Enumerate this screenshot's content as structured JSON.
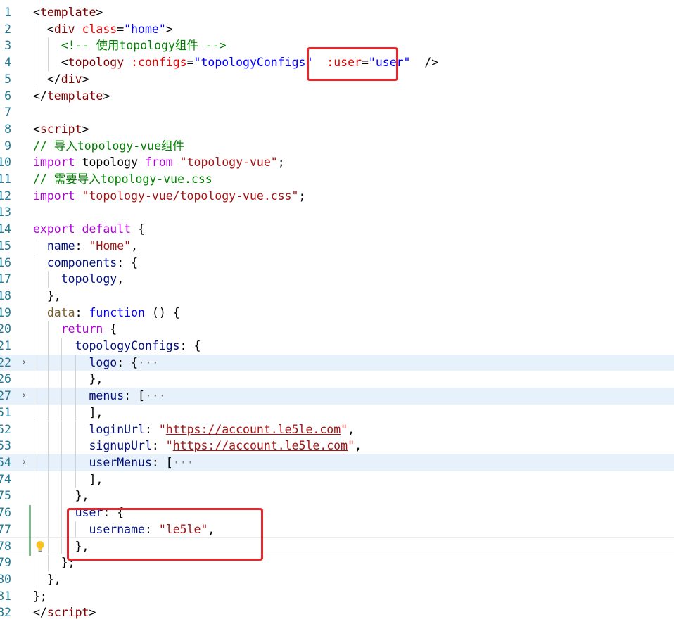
{
  "editor": {
    "lines": [
      {
        "n": "1",
        "fold": "",
        "cls": "",
        "html_tokens": [
          [
            "t-punc",
            "<"
          ],
          [
            "t-tag",
            "template"
          ],
          [
            "t-punc",
            ">"
          ]
        ]
      },
      {
        "n": "2",
        "fold": "",
        "cls": "",
        "html_tokens": [
          [
            "t-punc",
            "  <"
          ],
          [
            "t-tag",
            "div"
          ],
          [
            "t-punc",
            " "
          ],
          [
            "t-attr",
            "class"
          ],
          [
            "t-punc",
            "="
          ],
          [
            "t-kw",
            "\"home\""
          ],
          [
            "t-punc",
            ">"
          ]
        ]
      },
      {
        "n": "3",
        "fold": "",
        "cls": "",
        "html_tokens": [
          [
            "t-com",
            "    <!-- 使用topology组件 -->"
          ]
        ]
      },
      {
        "n": "4",
        "fold": "",
        "cls": "",
        "html_tokens": [
          [
            "t-punc",
            "    <"
          ],
          [
            "t-tag",
            "topology"
          ],
          [
            "t-punc",
            " "
          ],
          [
            "t-attr",
            ":configs"
          ],
          [
            "t-punc",
            "="
          ],
          [
            "t-kw",
            "\"topologyConfigs\""
          ],
          [
            "t-punc",
            "  "
          ],
          [
            "t-attr",
            ":user"
          ],
          [
            "t-punc",
            "="
          ],
          [
            "t-kw",
            "\"user\""
          ],
          [
            "t-punc",
            "  />"
          ]
        ]
      },
      {
        "n": "5",
        "fold": "",
        "cls": "",
        "html_tokens": [
          [
            "t-punc",
            "  </"
          ],
          [
            "t-tag",
            "div"
          ],
          [
            "t-punc",
            ">"
          ]
        ]
      },
      {
        "n": "6",
        "fold": "",
        "cls": "",
        "html_tokens": [
          [
            "t-punc",
            "</"
          ],
          [
            "t-tag",
            "template"
          ],
          [
            "t-punc",
            ">"
          ]
        ]
      },
      {
        "n": "7",
        "fold": "",
        "cls": "",
        "html_tokens": []
      },
      {
        "n": "8",
        "fold": "",
        "cls": "",
        "html_tokens": [
          [
            "t-punc",
            "<"
          ],
          [
            "t-tag",
            "script"
          ],
          [
            "t-punc",
            ">"
          ]
        ]
      },
      {
        "n": "9",
        "fold": "",
        "cls": "",
        "html_tokens": [
          [
            "t-com",
            "// 导入topology-vue组件"
          ]
        ]
      },
      {
        "n": "10",
        "fold": "",
        "cls": "",
        "html_tokens": [
          [
            "t-ctl",
            "import"
          ],
          [
            "t-punc",
            " topology "
          ],
          [
            "t-ctl",
            "from"
          ],
          [
            "t-punc",
            " "
          ],
          [
            "t-str",
            "\"topology-vue\""
          ],
          [
            "t-punc",
            ";"
          ]
        ]
      },
      {
        "n": "11",
        "fold": "",
        "cls": "",
        "html_tokens": [
          [
            "t-com",
            "// 需要导入topology-vue.css"
          ]
        ]
      },
      {
        "n": "12",
        "fold": "",
        "cls": "",
        "html_tokens": [
          [
            "t-ctl",
            "import"
          ],
          [
            "t-punc",
            " "
          ],
          [
            "t-str",
            "\"topology-vue/topology-vue.css\""
          ],
          [
            "t-punc",
            ";"
          ]
        ]
      },
      {
        "n": "13",
        "fold": "",
        "cls": "",
        "html_tokens": []
      },
      {
        "n": "14",
        "fold": "",
        "cls": "",
        "html_tokens": [
          [
            "t-ctl",
            "export"
          ],
          [
            "t-punc",
            " "
          ],
          [
            "t-ctl",
            "default"
          ],
          [
            "t-punc",
            " {"
          ]
        ]
      },
      {
        "n": "15",
        "fold": "",
        "cls": "",
        "html_tokens": [
          [
            "t-punc",
            "  "
          ],
          [
            "t-prop",
            "name"
          ],
          [
            "t-punc",
            ": "
          ],
          [
            "t-str",
            "\"Home\""
          ],
          [
            "t-punc",
            ","
          ]
        ]
      },
      {
        "n": "16",
        "fold": "",
        "cls": "",
        "html_tokens": [
          [
            "t-punc",
            "  "
          ],
          [
            "t-prop",
            "components"
          ],
          [
            "t-punc",
            ": {"
          ]
        ]
      },
      {
        "n": "17",
        "fold": "",
        "cls": "",
        "html_tokens": [
          [
            "t-punc",
            "    "
          ],
          [
            "t-prop",
            "topology"
          ],
          [
            "t-punc",
            ","
          ]
        ]
      },
      {
        "n": "18",
        "fold": "",
        "cls": "",
        "html_tokens": [
          [
            "t-punc",
            "  },"
          ]
        ]
      },
      {
        "n": "19",
        "fold": "",
        "cls": "",
        "html_tokens": [
          [
            "t-punc",
            "  "
          ],
          [
            "t-fn",
            "data"
          ],
          [
            "t-punc",
            ": "
          ],
          [
            "t-kw",
            "function"
          ],
          [
            "t-punc",
            " () {"
          ]
        ]
      },
      {
        "n": "20",
        "fold": "",
        "cls": "",
        "html_tokens": [
          [
            "t-punc",
            "    "
          ],
          [
            "t-ctl",
            "return"
          ],
          [
            "t-punc",
            " {"
          ]
        ]
      },
      {
        "n": "21",
        "fold": "",
        "cls": "",
        "html_tokens": [
          [
            "t-punc",
            "      "
          ],
          [
            "t-prop",
            "topologyConfigs"
          ],
          [
            "t-punc",
            ": {"
          ]
        ]
      },
      {
        "n": "22",
        "fold": "›",
        "cls": "folded",
        "html_tokens": [
          [
            "t-punc",
            "        "
          ],
          [
            "t-prop",
            "logo"
          ],
          [
            "t-punc",
            ": {"
          ],
          [
            "t-fold",
            "···"
          ]
        ]
      },
      {
        "n": "26",
        "fold": "",
        "cls": "",
        "html_tokens": [
          [
            "t-punc",
            "        },"
          ]
        ]
      },
      {
        "n": "27",
        "fold": "›",
        "cls": "folded",
        "html_tokens": [
          [
            "t-punc",
            "        "
          ],
          [
            "t-prop",
            "menus"
          ],
          [
            "t-punc",
            ": ["
          ],
          [
            "t-fold",
            "···"
          ]
        ]
      },
      {
        "n": "51",
        "fold": "",
        "cls": "",
        "html_tokens": [
          [
            "t-punc",
            "        ],"
          ]
        ]
      },
      {
        "n": "52",
        "fold": "",
        "cls": "",
        "html_tokens": [
          [
            "t-punc",
            "        "
          ],
          [
            "t-prop",
            "loginUrl"
          ],
          [
            "t-punc",
            ": "
          ],
          [
            "t-str",
            "\""
          ],
          [
            "t-str link",
            "https://account.le5le.com"
          ],
          [
            "t-str",
            "\""
          ],
          [
            "t-punc",
            ","
          ]
        ]
      },
      {
        "n": "53",
        "fold": "",
        "cls": "",
        "html_tokens": [
          [
            "t-punc",
            "        "
          ],
          [
            "t-prop",
            "signupUrl"
          ],
          [
            "t-punc",
            ": "
          ],
          [
            "t-str",
            "\""
          ],
          [
            "t-str link",
            "https://account.le5le.com"
          ],
          [
            "t-str",
            "\""
          ],
          [
            "t-punc",
            ","
          ]
        ]
      },
      {
        "n": "54",
        "fold": "›",
        "cls": "folded",
        "html_tokens": [
          [
            "t-punc",
            "        "
          ],
          [
            "t-prop",
            "userMenus"
          ],
          [
            "t-punc",
            ": ["
          ],
          [
            "t-fold",
            "···"
          ]
        ]
      },
      {
        "n": "74",
        "fold": "",
        "cls": "",
        "html_tokens": [
          [
            "t-punc",
            "        ],"
          ]
        ]
      },
      {
        "n": "75",
        "fold": "",
        "cls": "",
        "html_tokens": [
          [
            "t-punc",
            "      },"
          ]
        ]
      },
      {
        "n": "76",
        "fold": "",
        "cls": "",
        "html_tokens": [
          [
            "t-punc",
            "      "
          ],
          [
            "t-prop",
            "user"
          ],
          [
            "t-punc",
            ": {"
          ]
        ]
      },
      {
        "n": "77",
        "fold": "",
        "cls": "",
        "html_tokens": [
          [
            "t-punc",
            "        "
          ],
          [
            "t-prop",
            "username"
          ],
          [
            "t-punc",
            ": "
          ],
          [
            "t-str",
            "\"le5le\""
          ],
          [
            "t-punc",
            ","
          ]
        ]
      },
      {
        "n": "78",
        "fold": "",
        "cls": "current",
        "html_tokens": [
          [
            "t-punc",
            "      },"
          ]
        ]
      },
      {
        "n": "79",
        "fold": "",
        "cls": "",
        "html_tokens": [
          [
            "t-punc",
            "    };"
          ]
        ]
      },
      {
        "n": "80",
        "fold": "",
        "cls": "",
        "html_tokens": [
          [
            "t-punc",
            "  },"
          ]
        ]
      },
      {
        "n": "81",
        "fold": "",
        "cls": "",
        "html_tokens": [
          [
            "t-punc",
            "};"
          ]
        ]
      },
      {
        "n": "82",
        "fold": "",
        "cls": "",
        "html_tokens": [
          [
            "t-punc",
            "</"
          ],
          [
            "t-tag",
            "script"
          ],
          [
            "t-punc",
            ">"
          ]
        ]
      }
    ],
    "colors": {
      "highlight_box": "#e8262b",
      "folded_line_bg": "#e7f1fb",
      "modified_gutter": "#81b88b",
      "line_number": "#237893"
    },
    "icons": {
      "bulb": "lightbulb-icon",
      "fold": "chevron-right-icon"
    }
  }
}
